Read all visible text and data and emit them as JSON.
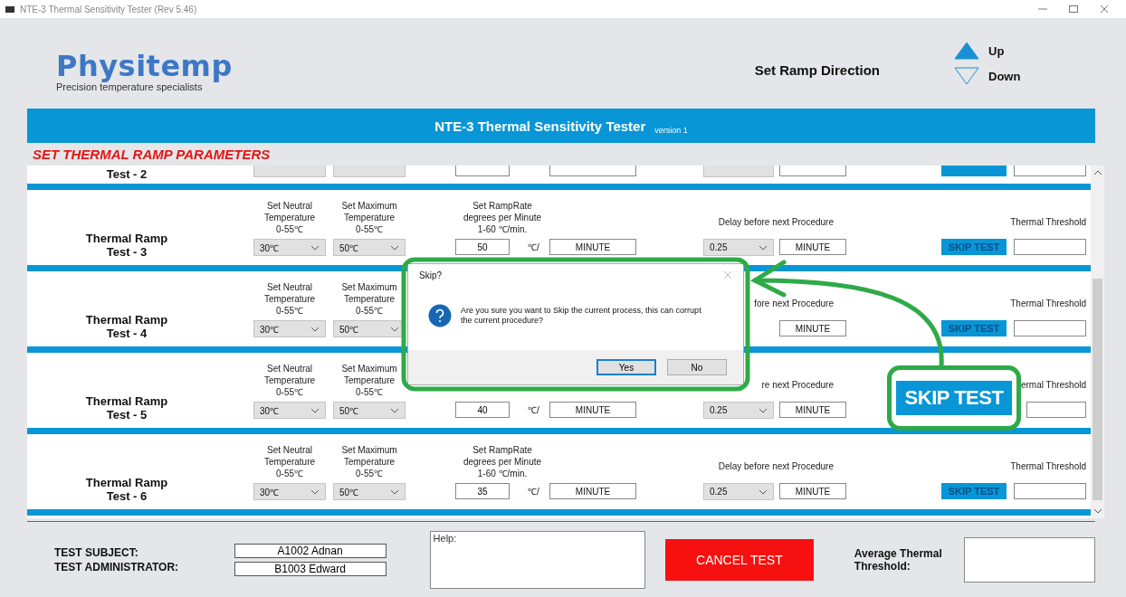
{
  "window": {
    "title": "NTE-3 Thermal Sensitivity Tester (Rev 5.46)"
  },
  "logo": {
    "name": "Physitemp",
    "tagline": "Precision temperature specialists"
  },
  "ramp_direction": {
    "label": "Set Ramp Direction",
    "options": [
      {
        "kind": "up",
        "label": "Up",
        "selected": true
      },
      {
        "kind": "down",
        "label": "Down",
        "selected": false
      }
    ]
  },
  "banner": {
    "title": "NTE-3 Thermal Sensitivity Tester",
    "version": "version 1"
  },
  "section_title": "SET THERMAL RAMP PARAMETERS",
  "partial_row": {
    "test": "Test - 2"
  },
  "rows": [
    {
      "title": "Thermal Ramp",
      "test": "Test - 3",
      "neutral_label": [
        "Set Neutral",
        "Temperature",
        "0-55℃"
      ],
      "neutral_value": "30℃",
      "max_label": [
        "Set Maximum",
        "Temperature",
        "0-55℃"
      ],
      "max_value": "50℃",
      "ramp_label": [
        "Set RampRate",
        "degrees per Minute",
        "1-60 ℃/min."
      ],
      "rate": "50",
      "rate_unit": "℃/",
      "rate_minute": "MINUTE",
      "delay_label": "Delay before next Procedure",
      "delay_value": "0.25",
      "delay_minute": "MINUTE",
      "skip": "SKIP TEST",
      "threshold_label": "Thermal Threshold"
    },
    {
      "title": "Thermal Ramp",
      "test": "Test - 4",
      "neutral_label": [
        "Set Neutral",
        "Temperature",
        "0-55℃"
      ],
      "neutral_value": "30℃",
      "max_label": [
        "Set Maximum",
        "Temperature",
        "0-55℃"
      ],
      "max_value": "50℃",
      "delay_label": "fore next Procedure",
      "delay_minute": "MINUTE",
      "skip": "SKIP TEST",
      "threshold_label": "Thermal Threshold"
    },
    {
      "title": "Thermal Ramp",
      "test": "Test - 5",
      "neutral_label": [
        "Set Neutral",
        "Temperature",
        "0-55℃"
      ],
      "neutral_value": "30℃",
      "max_label": [
        "Set Maximum",
        "Temperature",
        "0-55℃"
      ],
      "max_value": "50℃",
      "rate": "40",
      "rate_unit": "℃/",
      "rate_minute": "MINUTE",
      "delay_label": "re next Procedure",
      "delay_value": "0.25",
      "delay_minute": "MINUTE",
      "threshold_label": "ermal Threshold"
    },
    {
      "title": "Thermal Ramp",
      "test": "Test - 6",
      "neutral_label": [
        "Set Neutral",
        "Temperature",
        "0-55℃"
      ],
      "neutral_value": "30℃",
      "max_label": [
        "Set Maximum",
        "Temperature",
        "0-55℃"
      ],
      "max_value": "50℃",
      "ramp_label": [
        "Set RampRate",
        "degrees per Minute",
        "1-60 ℃/min."
      ],
      "rate": "35",
      "rate_unit": "℃/",
      "rate_minute": "MINUTE",
      "delay_label": "Delay before next Procedure",
      "delay_value": "0.25",
      "delay_minute": "MINUTE",
      "skip": "SKIP TEST",
      "threshold_label": "Thermal Threshold"
    }
  ],
  "dialog": {
    "title": "Skip?",
    "message": "Are you sure you want to Skip the current process, this can corrupt the current procedure?",
    "buttons": [
      {
        "label": "Yes",
        "selected": true
      },
      {
        "label": "No",
        "selected": false
      }
    ]
  },
  "annotation": {
    "callout": "SKIP TEST"
  },
  "footer": {
    "subject_label": "TEST SUBJECT:",
    "subject": "A1002 Adnan",
    "admin_label": "TEST ADMINISTRATOR:",
    "admin": "B1003 Edward",
    "help_placeholder": "Help:",
    "cancel": "CANCEL TEST",
    "average_label": "Average Thermal Threshold:"
  }
}
